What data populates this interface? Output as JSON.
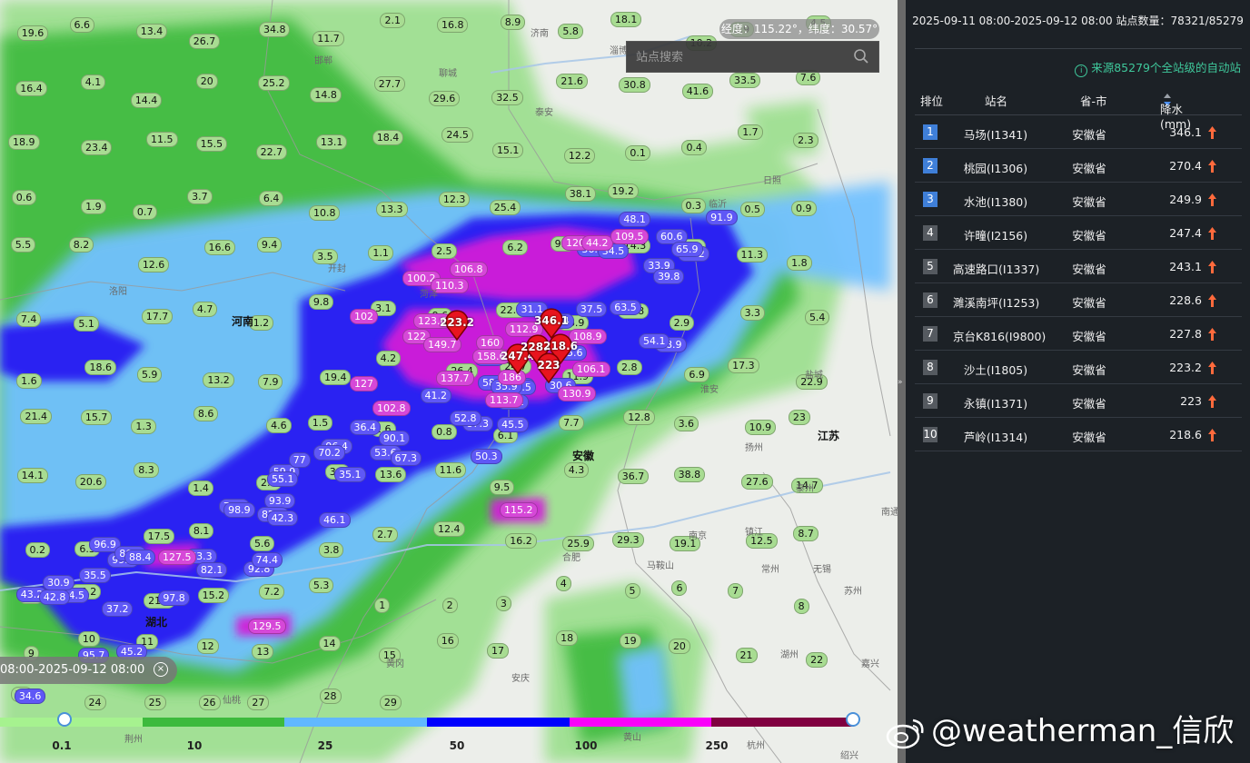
{
  "map": {
    "coordinate_readout": "经度：115.22°，纬度：30.57°",
    "search_placeholder": "站点搜索",
    "time_label": "08:00-2025-09-12 08:00",
    "labels": [
      {
        "text": "河南",
        "kind": "prov"
      },
      {
        "text": "湖北",
        "kind": "prov"
      },
      {
        "text": "安徽",
        "kind": "prov"
      },
      {
        "text": "江苏",
        "kind": "prov"
      },
      {
        "text": "济南",
        "kind": "city"
      },
      {
        "text": "聊城",
        "kind": "city"
      },
      {
        "text": "邯郸",
        "kind": "city"
      },
      {
        "text": "淄博",
        "kind": "city"
      },
      {
        "text": "泰安",
        "kind": "city"
      },
      {
        "text": "菏泽",
        "kind": "city"
      },
      {
        "text": "洛阳",
        "kind": "city"
      },
      {
        "text": "开封",
        "kind": "city"
      },
      {
        "text": "南京",
        "kind": "city"
      },
      {
        "text": "镇江",
        "kind": "city"
      },
      {
        "text": "常州",
        "kind": "city"
      },
      {
        "text": "无锡",
        "kind": "city"
      },
      {
        "text": "苏州",
        "kind": "city"
      },
      {
        "text": "湖州",
        "kind": "city"
      },
      {
        "text": "嘉兴",
        "kind": "city"
      },
      {
        "text": "杭州",
        "kind": "city"
      },
      {
        "text": "绍兴",
        "kind": "city"
      },
      {
        "text": "合肥",
        "kind": "city"
      },
      {
        "text": "马鞍山",
        "kind": "city"
      },
      {
        "text": "安庆",
        "kind": "city"
      },
      {
        "text": "黄冈",
        "kind": "city"
      },
      {
        "text": "仙桃",
        "kind": "city"
      },
      {
        "text": "荆州",
        "kind": "city"
      },
      {
        "text": "黄山",
        "kind": "city"
      },
      {
        "text": "泰州",
        "kind": "city"
      },
      {
        "text": "扬州",
        "kind": "city"
      },
      {
        "text": "盐城",
        "kind": "city"
      },
      {
        "text": "淮安",
        "kind": "city"
      },
      {
        "text": "临沂",
        "kind": "city"
      },
      {
        "text": "日照",
        "kind": "city"
      },
      {
        "text": "南通",
        "kind": "city"
      }
    ],
    "markers": [
      "223.2",
      "346.1",
      "247.4",
      "228.6",
      "218.6",
      "223"
    ],
    "pink_values": [
      "120",
      "44.2",
      "109.5",
      "106.8",
      "100.2",
      "110.3",
      "102",
      "123.6",
      "122",
      "149.7",
      "160",
      "158.6",
      "127",
      "137.7",
      "102.8",
      "106.1",
      "130.9",
      "115.2",
      "127.5",
      "129.5",
      "113.7",
      "186",
      "108.9",
      "112.9"
    ],
    "blue_values": [
      "34.6",
      "54.5",
      "95.7",
      "43.2",
      "42.8",
      "30.9",
      "37.2",
      "45.2",
      "35.5",
      "96.9",
      "99.4",
      "86.3",
      "88.4",
      "97.8",
      "73.3",
      "92.8",
      "82.1",
      "78.3",
      "93.9",
      "82.5",
      "74.4",
      "98.9",
      "59.9",
      "46.1",
      "42.3",
      "55.1",
      "36.4",
      "96.4",
      "77",
      "90.1",
      "70.2",
      "53.6",
      "35.1",
      "67.3",
      "66.8",
      "50.3",
      "58.3",
      "41.2",
      "45.5",
      "38.3",
      "87.3",
      "52.8",
      "39.5",
      "35.9",
      "49.5",
      "31.1",
      "45.4",
      "40.2",
      "37.5",
      "30.6",
      "55.6",
      "63.5",
      "33.9",
      "36.9",
      "48.9",
      "60.6",
      "34.5",
      "54.1",
      "48.1",
      "39.8",
      "91.9",
      "44.2",
      "65.9"
    ],
    "green_values": [
      "19.6",
      "6.6",
      "13.4",
      "26.7",
      "34.8",
      "11.7",
      "2.1",
      "16.8",
      "8.9",
      "5.8",
      "18.1",
      "10.2",
      "3.9",
      "4.5",
      "16.4",
      "4.1",
      "14.4",
      "20",
      "25.2",
      "14.8",
      "27.7",
      "29.6",
      "32.5",
      "21.6",
      "30.8",
      "41.6",
      "33.5",
      "7.6",
      "18.9",
      "23.4",
      "11.5",
      "15.5",
      "22.7",
      "13.1",
      "18.4",
      "24.5",
      "15.1",
      "12.2",
      "0.1",
      "0.4",
      "1.7",
      "2.3",
      "0.6",
      "1.9",
      "0.7",
      "3.7",
      "6.4",
      "10.8",
      "13.3",
      "12.3",
      "25.4",
      "38.1",
      "19.2",
      "0.3",
      "0.5",
      "0.9",
      "5.5",
      "8.2",
      "12.6",
      "16.6",
      "9.4",
      "3.5",
      "1.1",
      "2.5",
      "6.2",
      "9.9",
      "14.3",
      "28.1",
      "11.3",
      "1.8",
      "7.4",
      "5.1",
      "17.7",
      "4.7",
      "1.2",
      "9.8",
      "3.1",
      "9.6",
      "22.2",
      "16.9",
      "21.8",
      "2.9",
      "3.3",
      "5.4",
      "1.6",
      "18.6",
      "5.9",
      "13.2",
      "7.9",
      "19.4",
      "4.2",
      "26.4",
      "24.7",
      "11.9",
      "2.8",
      "6.9",
      "17.3",
      "22.9",
      "21.4",
      "15.7",
      "1.3",
      "8.6",
      "4.6",
      "1.5",
      "2.6",
      "0.8",
      "6.1",
      "7.7",
      "12.8",
      "3.6",
      "10.9",
      "23",
      "14.1",
      "20.6",
      "8.3",
      "1.4",
      "2.2",
      "3.2",
      "13.6",
      "11.6",
      "9.5",
      "4.3",
      "36.7",
      "38.8",
      "27.6",
      "14.7",
      "0.2",
      "6.3",
      "17.5",
      "8.1",
      "5.6",
      "3.8",
      "2.7",
      "12.4",
      "16.2",
      "25.9",
      "29.3",
      "19.1",
      "12.5",
      "8.7",
      "6.7",
      "33.2",
      "21.3",
      "15.2",
      "7.2",
      "5.3",
      "1",
      "2",
      "3",
      "4",
      "5",
      "6",
      "7",
      "8",
      "9",
      "10",
      "11",
      "12",
      "13",
      "14",
      "15",
      "16",
      "17",
      "18",
      "19",
      "20",
      "21",
      "22",
      "23",
      "24",
      "25",
      "26",
      "27",
      "28",
      "29"
    ]
  },
  "legend": {
    "ticks": [
      "0.1",
      "10",
      "25",
      "50",
      "100",
      "250"
    ],
    "colors": [
      "#a6f28f",
      "#3dba3d",
      "#61b8ff",
      "#0000fe",
      "#fa00fa",
      "#800040"
    ]
  },
  "watermark": "@weatherman_信欣",
  "panel": {
    "header": "2025-09-11 08:00-2025-09-12 08:00  站点数量：78321/85279",
    "source_note": "来源85279个全站级的自动站",
    "columns": {
      "rank": "排位",
      "name": "站名",
      "province": "省-市",
      "value": "降水(mm)"
    },
    "rows": [
      {
        "rank": "1",
        "name": "马场(I1341)",
        "province": "安徽省",
        "value": "346.1"
      },
      {
        "rank": "2",
        "name": "桃园(I1306)",
        "province": "安徽省",
        "value": "270.4"
      },
      {
        "rank": "3",
        "name": "水池(I1380)",
        "province": "安徽省",
        "value": "249.9"
      },
      {
        "rank": "4",
        "name": "许疃(I2156)",
        "province": "安徽省",
        "value": "247.4"
      },
      {
        "rank": "5",
        "name": "高速路口(I1337)",
        "province": "安徽省",
        "value": "243.1"
      },
      {
        "rank": "6",
        "name": "濉溪南坪(I1253)",
        "province": "安徽省",
        "value": "228.6"
      },
      {
        "rank": "7",
        "name": "京台K816(I9800)",
        "province": "安徽省",
        "value": "227.8"
      },
      {
        "rank": "8",
        "name": "沙土(I1805)",
        "province": "安徽省",
        "value": "223.2"
      },
      {
        "rank": "9",
        "name": "永镇(I1371)",
        "province": "安徽省",
        "value": "223"
      },
      {
        "rank": "10",
        "name": "芦岭(I1314)",
        "province": "安徽省",
        "value": "218.6"
      }
    ],
    "colors": {
      "top_rank": "#3f7fd8",
      "rank": "#555a60",
      "up_arrow": "#ff6a3c",
      "source": "#3fc89b"
    }
  }
}
